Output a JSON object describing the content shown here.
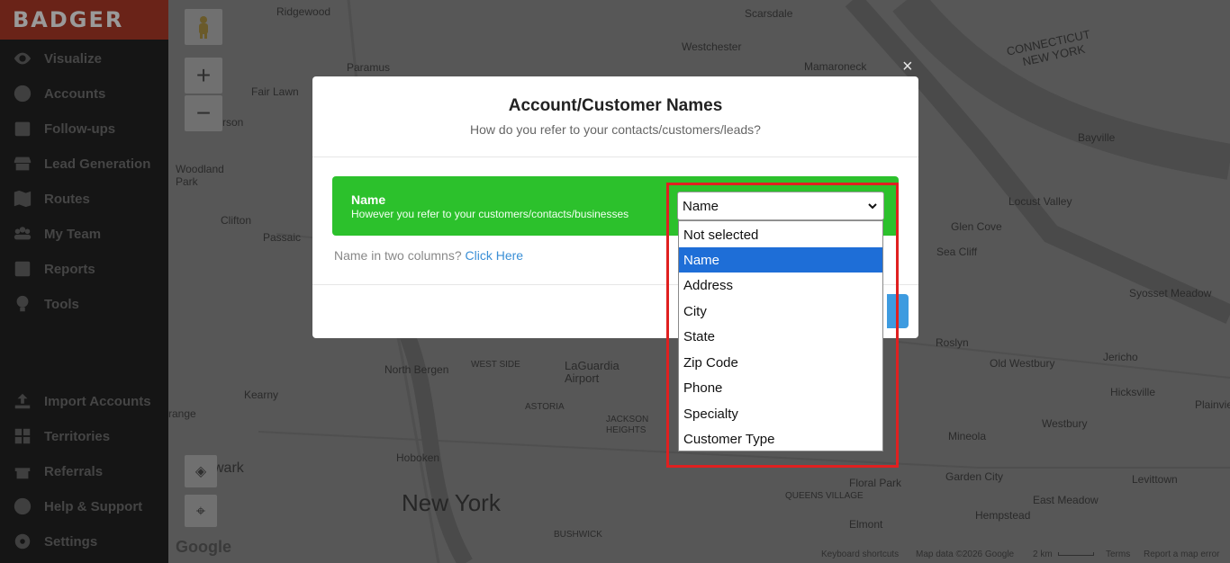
{
  "app": {
    "logo": "BADGER"
  },
  "sidebar": {
    "items": [
      {
        "label": "Visualize",
        "icon": "eye-icon"
      },
      {
        "label": "Accounts",
        "icon": "person-icon"
      },
      {
        "label": "Follow-ups",
        "icon": "calendar-icon"
      },
      {
        "label": "Lead Generation",
        "icon": "storefront-icon"
      },
      {
        "label": "Routes",
        "icon": "map-icon"
      },
      {
        "label": "My Team",
        "icon": "team-icon"
      },
      {
        "label": "Reports",
        "icon": "chart-icon"
      },
      {
        "label": "Tools",
        "icon": "lightbulb-icon"
      }
    ],
    "bottom_items": [
      {
        "label": "Import Accounts",
        "icon": "upload-icon"
      },
      {
        "label": "Territories",
        "icon": "grid-icon"
      },
      {
        "label": "Referrals",
        "icon": "gift-icon"
      },
      {
        "label": "Help & Support",
        "icon": "question-icon"
      },
      {
        "label": "Settings",
        "icon": "gear-icon"
      }
    ]
  },
  "map": {
    "labels": {
      "ridgewood": "Ridgewood",
      "paramus": "Paramus",
      "fair_lawn": "Fair Lawn",
      "rson": "rson",
      "woodland_park": "Woodland\nPark",
      "clifton": "Clifton",
      "passaic": "Passaic",
      "north_bergen": "North Bergen",
      "west_side": "WEST SIDE",
      "laguardia": "LaGuardia\nAirport",
      "kearny": "Kearny",
      "astoria": "ASTORIA",
      "jackson_heights": "JACKSON\nHEIGHTS",
      "range": "range",
      "hoboken": "Hoboken",
      "wark": "wark",
      "new_york": "New York",
      "queens_village": "QUEENS VILLAGE",
      "elmont": "Elmont",
      "bushwick": "BUSHWICK",
      "floral_park": "Floral Park",
      "scarsdale": "Scarsdale",
      "westchester": "Westchester",
      "mamaroneck": "Mamaroneck",
      "connecticut": "CONNECTICUT",
      "new_york_state": "NEW YORK",
      "bayville": "Bayville",
      "locust_valley": "Locust Valley",
      "glen_cove": "Glen Cove",
      "sea_cliff": "Sea Cliff",
      "syosset_meadow": "Syosset Meadow",
      "roslyn": "Roslyn",
      "old_westbury": "Old Westbury",
      "jericho": "Jericho",
      "hicksville": "Hicksville",
      "plainview": "Plainvie",
      "mineola": "Mineola",
      "westbury": "Westbury",
      "garden_city": "Garden City",
      "levittown": "Levittown",
      "east_meadow": "East Meadow",
      "hempstead": "Hempstead"
    },
    "zoom_in": "+",
    "zoom_out": "−",
    "google": "Google",
    "footer": {
      "shortcuts": "Keyboard shortcuts",
      "map_data": "Map data ©2026 Google",
      "scale": "2 km",
      "terms": "Terms",
      "report": "Report a map error"
    }
  },
  "modal": {
    "close": "×",
    "title": "Account/Customer Names",
    "subtitle": "How do you refer to your contacts/customers/leads?",
    "field_label": "Name",
    "field_hint": "However you refer to your customers/contacts/businesses",
    "two_columns_text": "Name in two columns?",
    "two_columns_link": "Click Here",
    "select": {
      "value": "Name",
      "options": [
        "Not selected",
        "Name",
        "Address",
        "City",
        "State",
        "Zip Code",
        "Phone",
        "Specialty",
        "Customer Type"
      ],
      "selected_index": 1
    }
  }
}
